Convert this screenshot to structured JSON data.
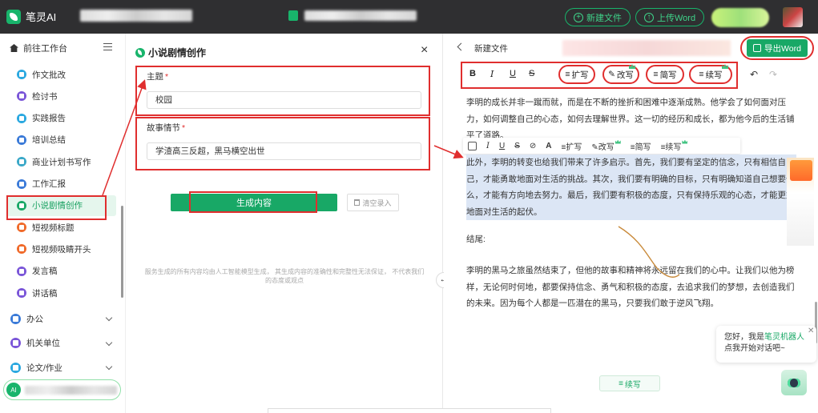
{
  "app": {
    "name": "笔灵AI"
  },
  "topbar": {
    "new_doc": "新建文件",
    "upload": "上传Word"
  },
  "sidebar": {
    "workspace": "前往工作台",
    "items": [
      {
        "label": "作文批改",
        "color": "#2aa8e0"
      },
      {
        "label": "检讨书",
        "color": "#7a55d8"
      },
      {
        "label": "实践报告",
        "color": "#2aa8e0"
      },
      {
        "label": "培训总结",
        "color": "#3a7ad8"
      },
      {
        "label": "商业计划书写作",
        "color": "#3aa8c8"
      },
      {
        "label": "工作汇报",
        "color": "#3a7ad8"
      },
      {
        "label": "小说剧情创作",
        "color": "#18a866"
      },
      {
        "label": "短视频标题",
        "color": "#f06a2a"
      },
      {
        "label": "短视频吸睛开头",
        "color": "#f06a2a"
      },
      {
        "label": "发言稿",
        "color": "#7a55d8"
      },
      {
        "label": "讲话稿",
        "color": "#7a55d8"
      }
    ],
    "groups": [
      {
        "label": "办公",
        "color": "#3a7ad8"
      },
      {
        "label": "机关单位",
        "color": "#7a55d8"
      },
      {
        "label": "论文/作业",
        "color": "#2aa8e0"
      }
    ],
    "user_avatar": "AI"
  },
  "form": {
    "title": "小说剧情创作",
    "close": "×",
    "theme_label": "主题",
    "theme_value": "校园",
    "story_label": "故事情节",
    "story_value": "学渣高三反超，黑马横空出世",
    "required_mark": "*",
    "generate": "生成内容",
    "clear": "清空录入",
    "disclaimer_1": "服务生成的所有内容均由人工智能模型生成， 其生成内容的准确性和完整性无法保证， 不代表我们",
    "disclaimer_2": "的态度或观点"
  },
  "editor": {
    "doc_name": "新建文件",
    "export": "导出Word",
    "toolbar": {
      "bold": "B",
      "italic": "I",
      "underline": "U",
      "strike": "S",
      "expand": "扩写",
      "rewrite": "改写",
      "simplify": "简写",
      "continue": "续写",
      "undo": "↶",
      "redo": "↷"
    },
    "float_toolbar": {
      "italic": "I",
      "underline": "U",
      "strike": "S",
      "link": "⊘",
      "font": "A",
      "expand": "扩写",
      "rewrite": "改写",
      "simplify": "简写",
      "continue": "续写"
    },
    "paragraphs": {
      "p1": "李明的成长并非一蹴而就，而是在不断的挫折和困难中逐渐成熟。他学会了如何面对压力，如何调整自己的心态，如何去理解世界。这一切的经历和成长，都为他今后的生活铺平了道路。",
      "p2": "此外，李明的转变也给我们带来了许多启示。首先，我们要有坚定的信念，只有相信自己，才能勇敢地面对生活的挑战。其次，我们要有明确的目标，只有明确知道自己想要什么，才能有方向地去努力。最后，我们要有积极的态度，只有保持乐观的心态，才能更好地面对生活的起伏。",
      "p3": "结尾:",
      "p4": "李明的黑马之旅虽然结束了，但他的故事和精神将永远留在我们的心中。让我们以他为榜样，无论何时何地，都要保持信念、勇气和积极的态度，去追求我们的梦想，去创造我们的未来。因为每个人都是一匹潜在的黑马，只要我们敢于逆风飞翔。"
    },
    "continue_btn": "续写",
    "bot": {
      "greet_prefix": "您好，我是",
      "bot_name": "笔灵机器人",
      "greet_suffix": "点我开始对话吧~"
    },
    "resize_icon": "↔"
  },
  "colors": {
    "accent": "#18a866",
    "highlight": "#e02e2e",
    "topbar": "#2f2f31"
  }
}
